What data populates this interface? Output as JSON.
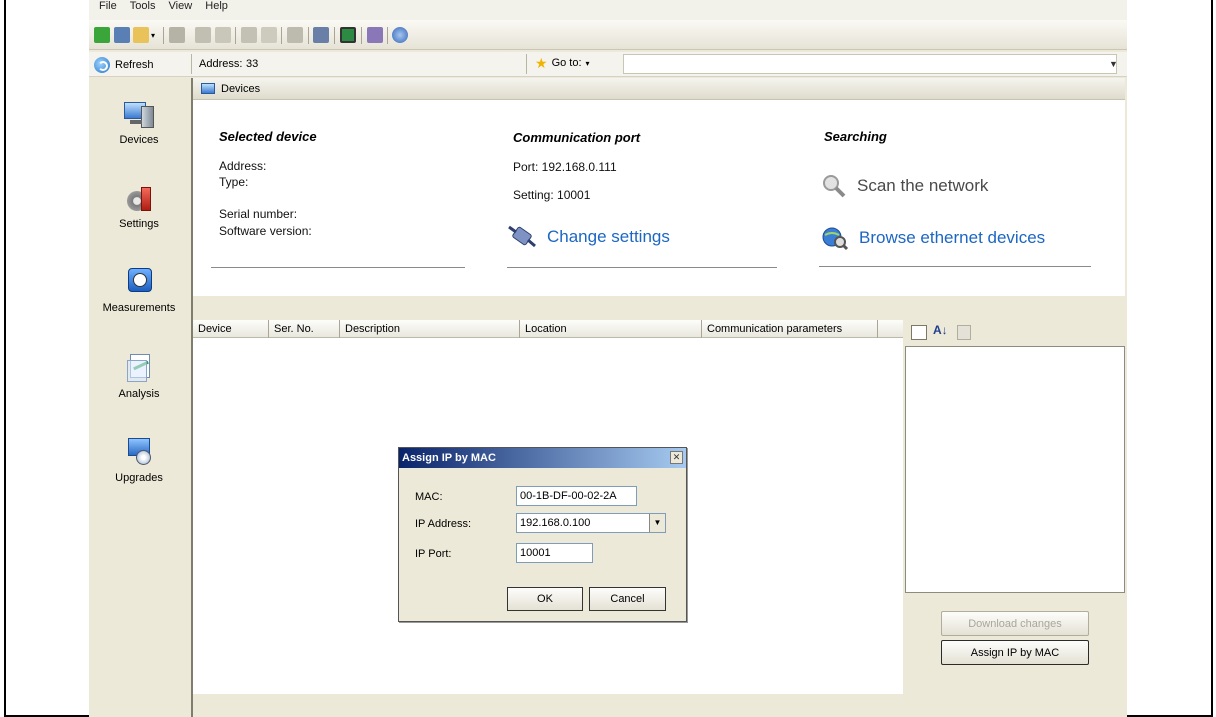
{
  "menu": {
    "items": [
      "File",
      "Tools",
      "View",
      "Help"
    ]
  },
  "address_bar": {
    "refresh_label": "Refresh",
    "address_label": "Address:",
    "address_value": "33",
    "goto_label": "Go to:"
  },
  "sidebar": {
    "items": [
      {
        "label": "Devices",
        "icon": "devices-icon"
      },
      {
        "label": "Settings",
        "icon": "settings-icon"
      },
      {
        "label": "Measurements",
        "icon": "measurements-icon"
      },
      {
        "label": "Analysis",
        "icon": "analysis-icon"
      },
      {
        "label": "Upgrades",
        "icon": "upgrades-icon"
      }
    ]
  },
  "panel": {
    "header": "Devices",
    "selected_device": {
      "title": "Selected device",
      "address_label": "Address:",
      "type_label": "Type:",
      "serial_label": "Serial number:",
      "software_label": "Software version:"
    },
    "communication_port": {
      "title": "Communication port",
      "port": "Port: 192.168.0.111",
      "setting": "Setting: 10001",
      "change_settings": "Change settings"
    },
    "searching": {
      "title": "Searching",
      "scan": "Scan the network",
      "browse": "Browse ethernet devices"
    }
  },
  "grid": {
    "columns": [
      "Device",
      "Ser. No.",
      "Description",
      "Location",
      "Communication parameters"
    ]
  },
  "properties": {
    "download_changes": "Download changes",
    "assign_ip_by_mac": "Assign IP by MAC"
  },
  "dialog": {
    "title": "Assign IP by MAC",
    "mac_label": "MAC:",
    "mac_value": "00-1B-DF-00-02-2A",
    "ip_label": "IP Address:",
    "ip_value": "192.168.0.100",
    "port_label": "IP Port:",
    "port_value": "10001",
    "ok": "OK",
    "cancel": "Cancel"
  },
  "colors": {
    "link_blue": "#1c66c4",
    "title_bar_start": "#0a246a",
    "title_bar_end": "#a6caf0"
  }
}
